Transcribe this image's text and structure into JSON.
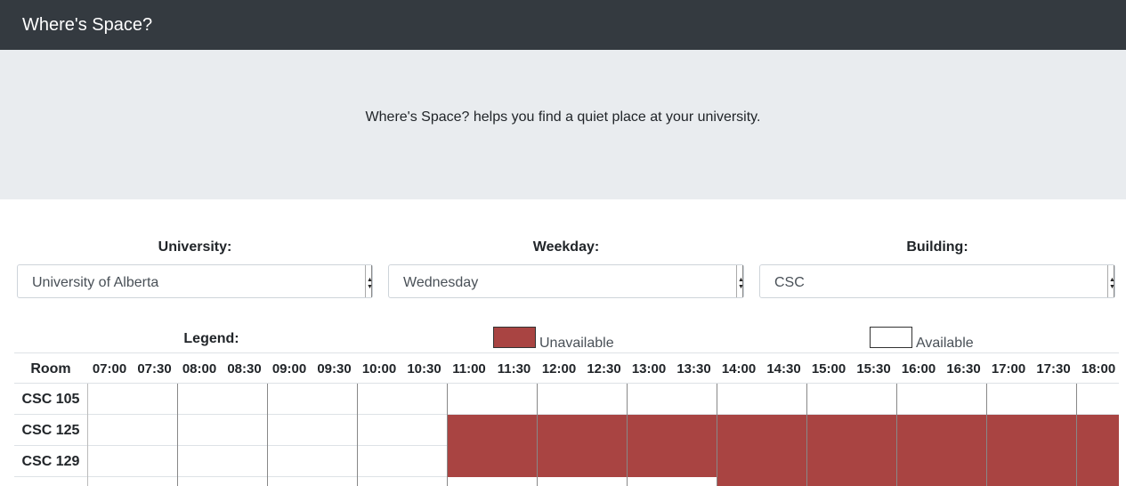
{
  "app": {
    "title": "Where's Space?"
  },
  "hero": {
    "text": "Where's Space? helps you find a quiet place at your university."
  },
  "filters": {
    "university": {
      "label": "University:",
      "value": "University of Alberta"
    },
    "weekday": {
      "label": "Weekday:",
      "value": "Wednesday"
    },
    "building": {
      "label": "Building:",
      "value": "CSC"
    }
  },
  "legend": {
    "label": "Legend:",
    "unavailable_label": "Unavailable",
    "available_label": "Available",
    "unavailable_color": "#a94442",
    "available_color": "#ffffff"
  },
  "schedule": {
    "room_header": "Room",
    "times": [
      "07:00",
      "07:30",
      "08:00",
      "08:30",
      "09:00",
      "09:30",
      "10:00",
      "10:30",
      "11:00",
      "11:30",
      "12:00",
      "12:30",
      "13:00",
      "13:30",
      "14:00",
      "14:30",
      "15:00",
      "15:30",
      "16:00",
      "16:30",
      "17:00",
      "17:30",
      "18:00"
    ],
    "rows": [
      {
        "room": "CSC 105",
        "busy": []
      },
      {
        "room": "CSC 125",
        "busy": [
          "11:00",
          "11:30",
          "12:00",
          "12:30",
          "13:00",
          "13:30",
          "14:00",
          "14:30",
          "15:00",
          "15:30",
          "16:00",
          "16:30",
          "17:00",
          "17:30",
          "18:00"
        ]
      },
      {
        "room": "CSC 129",
        "busy": [
          "11:00",
          "11:30",
          "12:00",
          "12:30",
          "13:00",
          "13:30",
          "14:00",
          "14:30",
          "15:00",
          "15:30",
          "16:00",
          "16:30",
          "17:00",
          "17:30",
          "18:00"
        ]
      },
      {
        "room": "",
        "busy": [
          "14:00",
          "14:30",
          "15:00",
          "15:30",
          "16:00",
          "16:30",
          "17:00",
          "17:30",
          "18:00"
        ]
      }
    ]
  }
}
